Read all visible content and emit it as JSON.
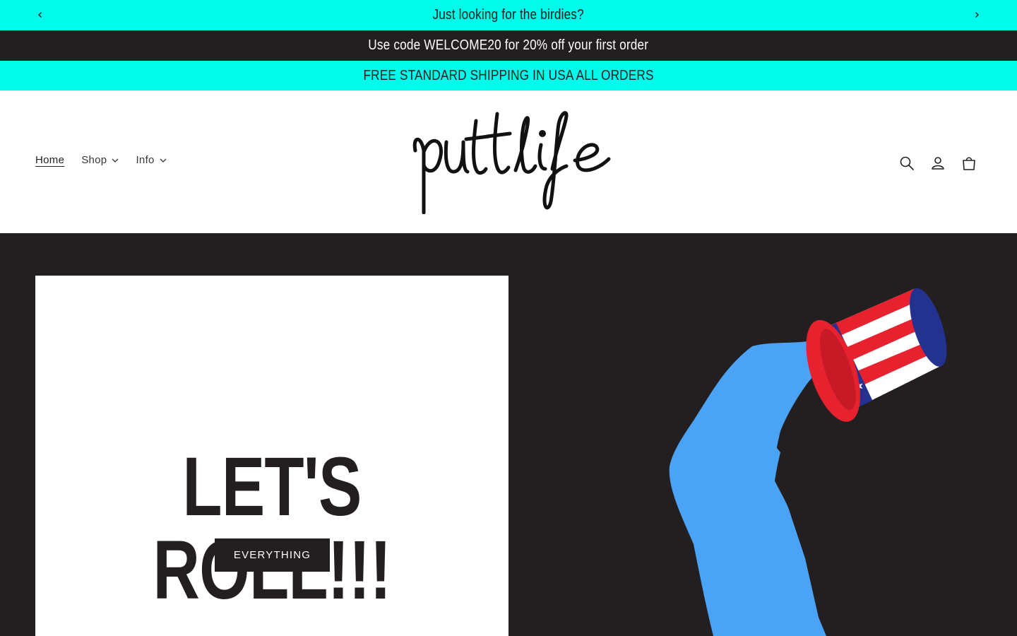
{
  "announcements": {
    "rotating_message": "Just looking for the birdies?",
    "promo_message": "Use code WELCOME20 for 20% off your first order",
    "shipping_message": "FREE STANDARD SHIPPING IN USA ALL ORDERS",
    "prev_icon": "chevron-left-icon",
    "next_icon": "chevron-right-icon"
  },
  "header": {
    "logo_text": "putt life",
    "nav": [
      {
        "label": "Home",
        "active": true
      },
      {
        "label": "Shop",
        "has_dropdown": true
      },
      {
        "label": "Info",
        "has_dropdown": true
      }
    ],
    "icons": [
      "search-icon",
      "account-icon",
      "cart-icon"
    ]
  },
  "hero": {
    "title": "LET'S ROLL!!!",
    "button_label": "EVERYTHING",
    "image": "golfer-silhouette-with-uncle-sam-hat"
  },
  "colors": {
    "accent_cyan": "#00fbea",
    "dark": "#231f20",
    "golfer_blue": "#4aa3f5",
    "hat_red": "#e8212e",
    "hat_navy": "#24328f"
  }
}
